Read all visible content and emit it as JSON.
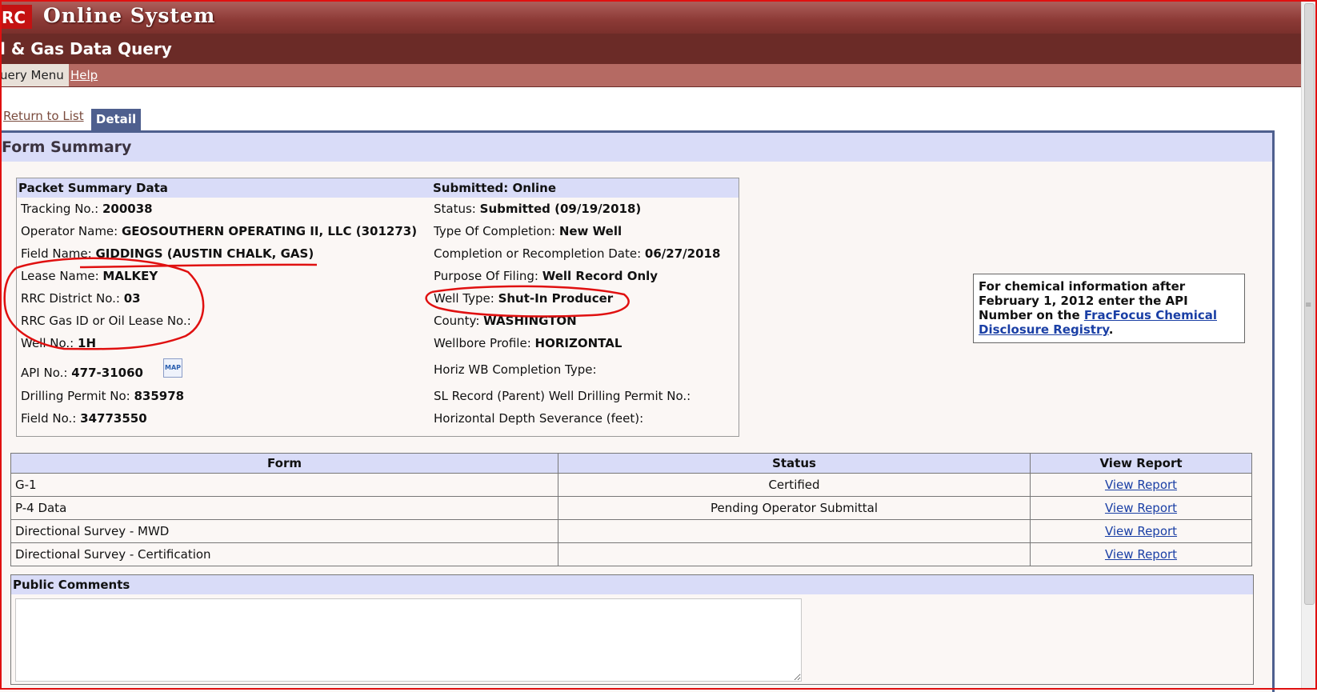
{
  "header": {
    "app_title": "Online System",
    "subtitle": "l & Gas Data Query",
    "menu": {
      "query_menu": "uery Menu",
      "help": "Help"
    }
  },
  "tabs": {
    "return": "Return to List",
    "detail": "Detail"
  },
  "panel_title": "Form Summary",
  "packet": {
    "heading_left": "Packet Summary Data",
    "heading_right": "Submitted: Online",
    "left": [
      {
        "label": "Tracking No.:",
        "value": "200038"
      },
      {
        "label": "Operator Name:",
        "value": "GEOSOUTHERN OPERATING II, LLC (301273)"
      },
      {
        "label": "Field Name:",
        "value": "GIDDINGS (AUSTIN CHALK, GAS)"
      },
      {
        "label": "Lease Name:",
        "value": "MALKEY"
      },
      {
        "label": "RRC District No.:",
        "value": "03"
      },
      {
        "label": "RRC Gas ID or Oil Lease No.:",
        "value": ""
      },
      {
        "label": "Well No.:",
        "value": "1H"
      },
      {
        "label": "API No.:",
        "value": "477-31060"
      },
      {
        "label": "Drilling Permit No:",
        "value": "835978"
      },
      {
        "label": "Field No.:",
        "value": "34773550"
      }
    ],
    "right": [
      {
        "label": "Status:",
        "value": "Submitted (09/19/2018)"
      },
      {
        "label": "Type Of Completion:",
        "value": "New Well"
      },
      {
        "label": "Completion or Recompletion Date:",
        "value": "06/27/2018"
      },
      {
        "label": "Purpose Of Filing:",
        "value": "Well Record Only"
      },
      {
        "label": "Well Type:",
        "value": "Shut-In Producer"
      },
      {
        "label": "County:",
        "value": "WASHINGTON"
      },
      {
        "label": "Wellbore Profile:",
        "value": "HORIZONTAL"
      },
      {
        "label": "Horiz WB Completion Type:",
        "value": ""
      },
      {
        "label": "SL Record (Parent) Well Drilling Permit No.:",
        "value": ""
      },
      {
        "label": "Horizontal Depth Severance (feet):",
        "value": ""
      }
    ],
    "map_icon_label": "MAP"
  },
  "chem_info": {
    "text": "For chemical information after February 1, 2012 enter the API Number on the ",
    "link": "FracFocus Chemical Disclosure Registry",
    "suffix": "."
  },
  "forms_table": {
    "headers": [
      "Form",
      "Status",
      "View Report"
    ],
    "rows": [
      {
        "form": "G-1",
        "status": "Certified",
        "link": "View Report"
      },
      {
        "form": "P-4 Data",
        "status": "Pending Operator Submittal",
        "link": "View Report"
      },
      {
        "form": "Directional Survey - MWD",
        "status": "",
        "link": "View Report"
      },
      {
        "form": "Directional Survey - Certification",
        "status": "",
        "link": "View Report"
      }
    ]
  },
  "comments": {
    "title": "Public Comments",
    "value": ""
  },
  "colors": {
    "annotation": "#e01010",
    "header_dark": "#6b2b27",
    "accent": "#4e5f8e"
  }
}
